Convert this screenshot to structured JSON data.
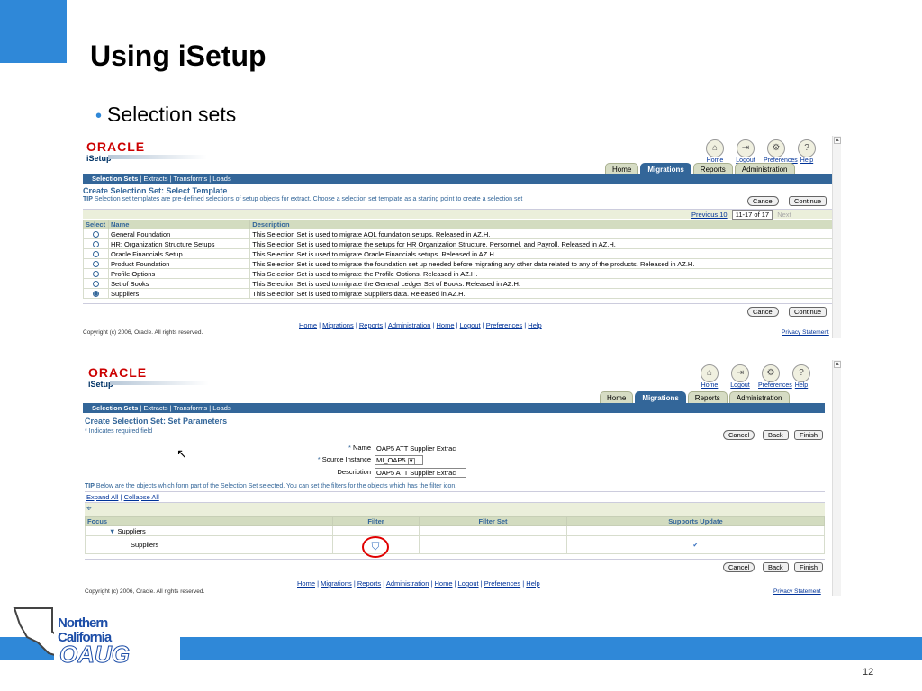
{
  "slide": {
    "title": "Using iSetup",
    "bullet": "Selection sets",
    "page_number": "12",
    "org_logo": {
      "line1": "Northern",
      "line2": "California",
      "line3": "OAUG"
    }
  },
  "app": {
    "brand": "ORACLE",
    "product": "iSetup",
    "global_icons": [
      {
        "icon": "home-icon",
        "glyph": "⌂",
        "label": "Home"
      },
      {
        "icon": "logout-icon",
        "glyph": "⇥",
        "label": "Logout"
      },
      {
        "icon": "preferences-icon",
        "glyph": "⚙",
        "label": "Preferences"
      },
      {
        "icon": "help-icon",
        "glyph": "?",
        "label": "Help"
      }
    ],
    "tabs": [
      "Home",
      "Migrations",
      "Reports",
      "Administration"
    ],
    "active_tab": "Migrations",
    "subnav": [
      "Selection Sets",
      "Extracts",
      "Transforms",
      "Loads"
    ],
    "footer_links": [
      "Home",
      "Migrations",
      "Reports",
      "Administration",
      "Home",
      "Logout",
      "Preferences",
      "Help"
    ],
    "copyright": "Copyright (c) 2006, Oracle. All rights reserved.",
    "privacy": "Privacy Statement"
  },
  "screen1": {
    "heading": "Create Selection Set: Select Template",
    "tip_label": "TIP",
    "tip_text": "Selection set templates are pre-defined selections of setup objects for extract. Choose a selection set template as a starting point to create a selection set",
    "cancel": "Cancel",
    "continue": "Continue",
    "nav": {
      "previous": "Previous 10",
      "range": "11-17 of 17",
      "next": "Next"
    },
    "columns": [
      "Select",
      "Name",
      "Description"
    ],
    "rows": [
      {
        "name": "General Foundation",
        "desc": "This Selection Set is used to migrate AOL foundation setups. Released in AZ.H.",
        "checked": false
      },
      {
        "name": "HR: Organization Structure Setups",
        "desc": "This Selection Set is used to migrate the setups for HR Organization Structure, Personnel, and Payroll. Released in AZ.H.",
        "checked": false
      },
      {
        "name": "Oracle Financials Setup",
        "desc": "This Selection Set is used to migrate Oracle Financials setups. Released in AZ.H.",
        "checked": false
      },
      {
        "name": "Product Foundation",
        "desc": "This Selection Set is used to migrate the foundation set up needed before migrating any other data related to any of the products. Released in AZ.H.",
        "checked": false
      },
      {
        "name": "Profile Options",
        "desc": "This Selection Set is used to migrate the Profile Options. Released in AZ.H.",
        "checked": false
      },
      {
        "name": "Set of Books",
        "desc": "This Selection Set is used to migrate the General Ledger Set of Books. Released in AZ.H.",
        "checked": false
      },
      {
        "name": "Suppliers",
        "desc": "This Selection Set is used to migrate Suppliers data. Released in AZ.H.",
        "checked": true
      }
    ]
  },
  "screen2": {
    "heading": "Create Selection Set: Set Parameters",
    "required_note": "* Indicates required field",
    "cancel": "Cancel",
    "back": "Back",
    "finish": "Finish",
    "fields": {
      "name_label": "Name",
      "name_value": "OAP5 ATT Supplier Extrac",
      "source_label": "Source Instance",
      "source_value": "MI_OAP5",
      "desc_label": "Description",
      "desc_value": "OAP5 ATT Supplier Extrac"
    },
    "tip_label": "TIP",
    "tip_text": "Below are the objects which form part of the Selection Set selected. You can set the filters for the objects which has the filter icon.",
    "expand_all": "Expand All",
    "collapse_all": "Collapse All",
    "columns": [
      "Focus",
      "Filter",
      "Filter Set",
      "Supports Update"
    ],
    "tree_parent": "Suppliers",
    "tree_child": "Suppliers"
  }
}
